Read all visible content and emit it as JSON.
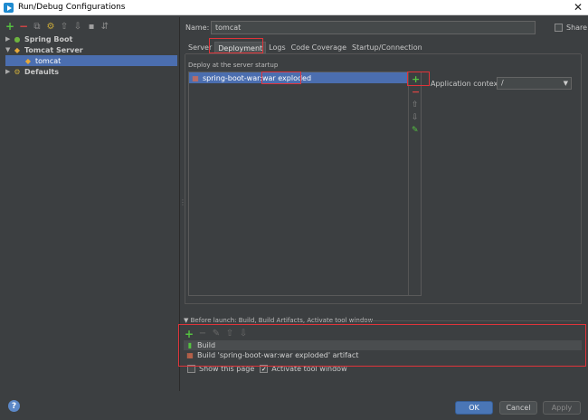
{
  "window": {
    "title": "Run/Debug Configurations",
    "close_glyph": "✕"
  },
  "left_toolbar": {
    "icons": [
      "add-icon",
      "remove-icon",
      "copy-icon",
      "wrench-icon",
      "move-up-icon",
      "move-down-icon",
      "folder-icon",
      "sort-icon"
    ],
    "add_glyph": "+",
    "remove_glyph": "−",
    "copy_glyph": "⧉",
    "wrench_glyph": "🔧",
    "up_glyph": "⇧",
    "down_glyph": "⇩",
    "folder_glyph": "▪",
    "sort_glyph": "⇵"
  },
  "tree": {
    "items": [
      {
        "label": "Spring Boot",
        "expanded": false
      },
      {
        "label": "Tomcat Server",
        "expanded": true
      },
      {
        "label": "tomcat",
        "selected": true
      },
      {
        "label": "Defaults",
        "expanded": false
      }
    ],
    "collapsed_glyph": "▶",
    "expanded_glyph": "▼"
  },
  "form": {
    "name_label": "Name:",
    "name_value": "tomcat",
    "share_label": "Share"
  },
  "tabs": [
    "Server",
    "Deployment",
    "Logs",
    "Code Coverage",
    "Startup/Connection"
  ],
  "active_tab": "Deployment",
  "deployment": {
    "section_label": "Deploy at the server startup",
    "artifact": "spring-boot-war:war exploded",
    "side_add": "+",
    "side_remove": "−",
    "side_up": "⇧",
    "side_down": "⇩",
    "side_edit": "✎"
  },
  "app_context": {
    "label": "Application context:",
    "value": "/",
    "dropdown_glyph": "▼"
  },
  "before_launch": {
    "label": "Before launch: Build, Build Artifacts, Activate tool window",
    "toggle_glyph": "▼",
    "items": [
      "Build",
      "Build 'spring-boot-war:war exploded' artifact"
    ],
    "add": "+",
    "remove": "−",
    "edit": "✎",
    "up": "⇧",
    "down": "⇩"
  },
  "options": {
    "show_this_page": "Show this page",
    "activate_tool_window": "Activate tool window",
    "check_glyph": "✓"
  },
  "buttons": {
    "help": "?",
    "ok": "OK",
    "cancel": "Cancel",
    "apply": "Apply"
  },
  "colors": {
    "accent": "#4b6eaf",
    "highlight_box": "#e0343a",
    "add_green": "#55c241",
    "remove_red": "#d64545"
  }
}
